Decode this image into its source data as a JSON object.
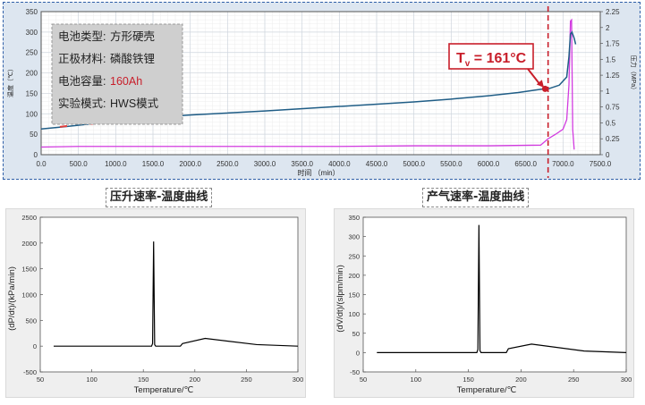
{
  "main": {
    "info_box": {
      "rows": [
        {
          "label": "电池类型:",
          "value": "方形硬壳"
        },
        {
          "label": "正极材料:",
          "value": "磷酸铁锂"
        },
        {
          "label": "电池容量:",
          "value": "160Ah"
        },
        {
          "label": "实验模式:",
          "value": "HWS模式"
        }
      ]
    },
    "callout": {
      "prefix": "T",
      "subscript": "v",
      "text": " = 161°C"
    }
  },
  "colors": {
    "temperature": "#1f5d86",
    "pressure": "#d23be0",
    "marker": "#c81e2a",
    "sub_line": "#000000"
  },
  "chart_data": [
    {
      "type": "line",
      "xlabel": "时间 （min）",
      "ylabel": "温度（℃）",
      "y2label": "压力（MPa）",
      "xlim": [
        0,
        7500
      ],
      "ylim": [
        0,
        350
      ],
      "y2lim": [
        0,
        2.25
      ],
      "x_ticks": [
        "0.0",
        "500.0",
        "1000.0",
        "1500.0",
        "2000.0",
        "2500.0",
        "3000.0",
        "3500.0",
        "4000.0",
        "4500.0",
        "5000.0",
        "5500.0",
        "6000.0",
        "6500.0",
        "7000.0",
        "7500.0"
      ],
      "y_ticks": [
        "0",
        "50",
        "100",
        "150",
        "200",
        "250",
        "300",
        "350"
      ],
      "y2_ticks": [
        "0",
        "0.25",
        "0.5",
        "0.75",
        "1",
        "1.25",
        "1.5",
        "1.75",
        "2",
        "2.25"
      ],
      "grid": true,
      "vline_x": 6800,
      "series": [
        {
          "axis": "left",
          "x": [
            0,
            300,
            700,
            1000,
            1500,
            2000,
            3000,
            4000,
            5000,
            5500,
            6000,
            6400,
            6700,
            6800,
            6950,
            7050,
            7080,
            7100,
            7120,
            7150,
            7170
          ],
          "y": [
            63,
            68,
            76,
            82,
            91,
            97,
            107,
            118,
            129,
            136,
            144,
            152,
            160,
            161,
            170,
            190,
            240,
            295,
            300,
            285,
            270
          ]
        },
        {
          "axis": "right",
          "x": [
            0,
            500,
            1000,
            2000,
            3000,
            4000,
            5000,
            6000,
            6700,
            6800,
            6900,
            7000,
            7050,
            7080,
            7100,
            7115,
            7130,
            7150
          ],
          "y": [
            0.12,
            0.13,
            0.13,
            0.13,
            0.13,
            0.13,
            0.14,
            0.14,
            0.15,
            0.25,
            0.32,
            0.4,
            0.55,
            1.1,
            2.1,
            2.12,
            0.4,
            0.08
          ]
        },
        {
          "axis": "left",
          "x": [
            300,
            700,
            1000,
            1500
          ],
          "y": [
            68,
            75,
            82,
            90
          ]
        }
      ]
    },
    {
      "type": "line",
      "title": "压升速率-温度曲线",
      "xlabel": "Temperature/℃",
      "ylabel": "(dP/dt)/(kPa/min)",
      "xlim": [
        50,
        300
      ],
      "ylim": [
        -500,
        2500
      ],
      "x_ticks": [
        "50",
        "100",
        "150",
        "200",
        "250",
        "300"
      ],
      "y_ticks": [
        "-500",
        "0",
        "500",
        "1000",
        "1500",
        "2000",
        "2500"
      ],
      "x": [
        63,
        100,
        150,
        158,
        159,
        160,
        161,
        162,
        186,
        188,
        210,
        260,
        300
      ],
      "y": [
        0,
        0,
        0,
        0,
        50,
        2030,
        30,
        0,
        0,
        50,
        150,
        30,
        0
      ]
    },
    {
      "type": "line",
      "title": "产气速率-温度曲线",
      "xlabel": "Temperature/℃",
      "ylabel": "(dV/dt)/(slpm/min)",
      "xlim": [
        50,
        300
      ],
      "ylim": [
        -50,
        350
      ],
      "x_ticks": [
        "50",
        "100",
        "150",
        "200",
        "250",
        "300"
      ],
      "y_ticks": [
        "-50",
        "0",
        "50",
        "100",
        "150",
        "200",
        "250",
        "300",
        "350"
      ],
      "x": [
        63,
        100,
        150,
        158,
        159,
        160,
        161,
        162,
        186,
        188,
        210,
        260,
        300
      ],
      "y": [
        0,
        0,
        0,
        0,
        8,
        330,
        5,
        0,
        0,
        10,
        22,
        4,
        0
      ]
    }
  ]
}
